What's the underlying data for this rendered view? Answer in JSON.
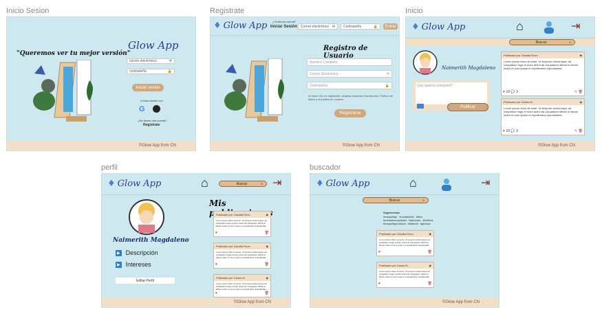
{
  "frames": {
    "login": {
      "label": "Inicio Sesion"
    },
    "register": {
      "label": "Registrate"
    },
    "home": {
      "label": "Inicio"
    },
    "profile": {
      "label": "perfil"
    },
    "search": {
      "label": "buscador"
    }
  },
  "brand": {
    "logo_text": "Glow App",
    "footer": "©Glow App from CN"
  },
  "login": {
    "quote": "\"Queremos ver tu mejor versión\"",
    "email_placeholder": "correo electrónico",
    "password_placeholder": "contraseña",
    "login_button": "Iniciar sesión",
    "or_login_with": "o inicia sesión con",
    "no_account": "¿No tienes una cuenta?",
    "register_link": "Regístrate"
  },
  "register": {
    "have_account": "¿Ya tienes cuenta?",
    "login_label": "Iniciar Sesión",
    "email_placeholder": "Correo electrónico",
    "password_placeholder": "Contraseña",
    "enter_button": "Entrar",
    "title": "Registro de Usuario",
    "name_placeholder": "Nombre Completo",
    "email2_placeholder": "Correo Electronico",
    "password2_placeholder": "Contraseña",
    "terms": "Al hacer clic en registrarte, aceptas nuestras Condiciones, Política de datos y la política de cookies.",
    "register_button": "Registrarse"
  },
  "home": {
    "search_placeholder": "Buscar",
    "user_name": "Naimerith Magdaleno",
    "composer_placeholder": "Que quieres compartir?",
    "publish_button": "Publicar"
  },
  "posts": [
    {
      "author": "Publicado por Claudia Rozo",
      "text": "Lorem ipsum dolor sit amet. Ut tempore doloremque ad voluptatum fuga et dolor animi ab voluptatum officiis in labore totam et eum ipsam et repellendus repudiandae.",
      "likes": "10",
      "comments": "3",
      "date": "26/04/22"
    },
    {
      "author": "Publicado por Carlos M.",
      "text": "Lorem ipsum dolor sit amet. Ut tempore doloremque ad voluptatum fuga et dolor animi ab voluptatum officiis in labore totam et eum ipsam et repellendus repudiandae.",
      "likes": "10",
      "comments": "3",
      "date": "26/04/22"
    }
  ],
  "profile": {
    "search_placeholder": "Buscar",
    "user_name": "Naimerith Magdaleno",
    "heading": "Mis publicaciones",
    "description": "Descripción",
    "interests": "Intereses",
    "edit_button": "Editar Perfil"
  },
  "search": {
    "search_placeholder": "Buscar",
    "suggestions_title": "Sugerencias",
    "suggestions": [
      "#maquillaje",
      "#cuidadofiel",
      "#feliz",
      "#cuidadoscapilares",
      "#skincare",
      "#belleza",
      "#maquillajenatural",
      "#tallerad",
      "#glowup"
    ]
  },
  "colors": {
    "background": "#cde9ef",
    "footer": "#f2dfc8",
    "accent": "#d1a77d",
    "logo": "#2f3a8f"
  }
}
